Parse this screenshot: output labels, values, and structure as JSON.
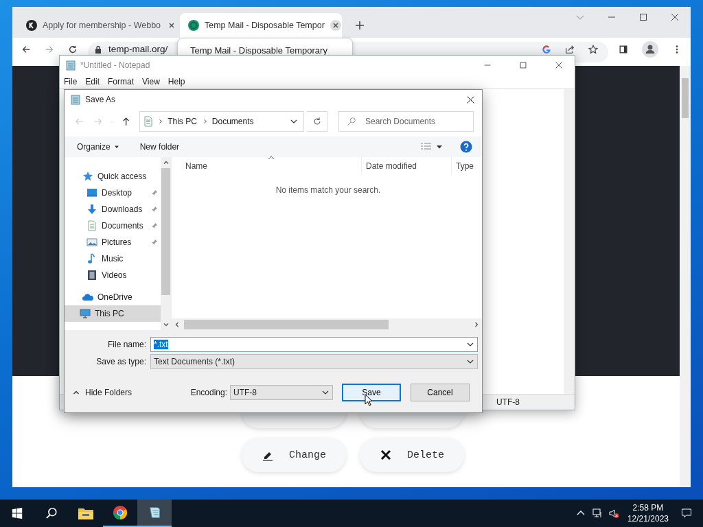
{
  "browser": {
    "tabs": [
      {
        "title": "Apply for membership - Webbo",
        "selected": false
      },
      {
        "title": "Temp Mail - Disposable Tempor",
        "selected": true
      }
    ],
    "address": "temp-mail.org/",
    "tab_tooltip": "Temp Mail - Disposable Temporary",
    "page_buttons": [
      {
        "label": "Change",
        "kind": "edit"
      },
      {
        "label": "Delete",
        "kind": "delete"
      }
    ]
  },
  "notepad": {
    "title": "*Untitled - Notepad",
    "menu": [
      "File",
      "Edit",
      "Format",
      "View",
      "Help"
    ],
    "status": "UTF-8"
  },
  "dialog": {
    "title": "Save As",
    "breadcrumb": [
      "This PC",
      "Documents"
    ],
    "search": {
      "placeholder": "Search Documents"
    },
    "toolbar": [
      "Organize",
      "New folder"
    ],
    "nav": [
      {
        "label": "Quick access",
        "kind": "star",
        "selected": false,
        "children": [
          {
            "label": "Desktop",
            "kind": "desktop",
            "pinned": true,
            "selected": false
          },
          {
            "label": "Downloads",
            "kind": "download",
            "pinned": true,
            "selected": false
          },
          {
            "label": "Documents",
            "kind": "document",
            "pinned": true,
            "selected": false
          },
          {
            "label": "Pictures",
            "kind": "pictures",
            "pinned": true,
            "selected": false
          },
          {
            "label": "Music",
            "kind": "music",
            "pinned": false,
            "selected": false
          },
          {
            "label": "Videos",
            "kind": "videos",
            "pinned": false,
            "selected": false
          }
        ]
      },
      {
        "label": "OneDrive",
        "kind": "cloud",
        "selected": false
      },
      {
        "label": "This PC",
        "kind": "pc",
        "selected": true
      }
    ],
    "columns": [
      "Name",
      "Date modified",
      "Type"
    ],
    "empty_message": "No items match your search.",
    "file_name": {
      "label": "File name:",
      "value": "*.txt",
      "highlighted": true
    },
    "save_as_type": {
      "label": "Save as type:",
      "value": "Text Documents (*.txt)"
    },
    "hide_folders": "Hide Folders",
    "encoding": {
      "label": "Encoding:",
      "value": "UTF-8"
    },
    "buttons": [
      {
        "label": "Save",
        "kind": "default"
      },
      {
        "label": "Cancel",
        "kind": "normal"
      }
    ]
  },
  "taskbar": {
    "time": "2:58 PM",
    "date": "12/21/2023"
  }
}
